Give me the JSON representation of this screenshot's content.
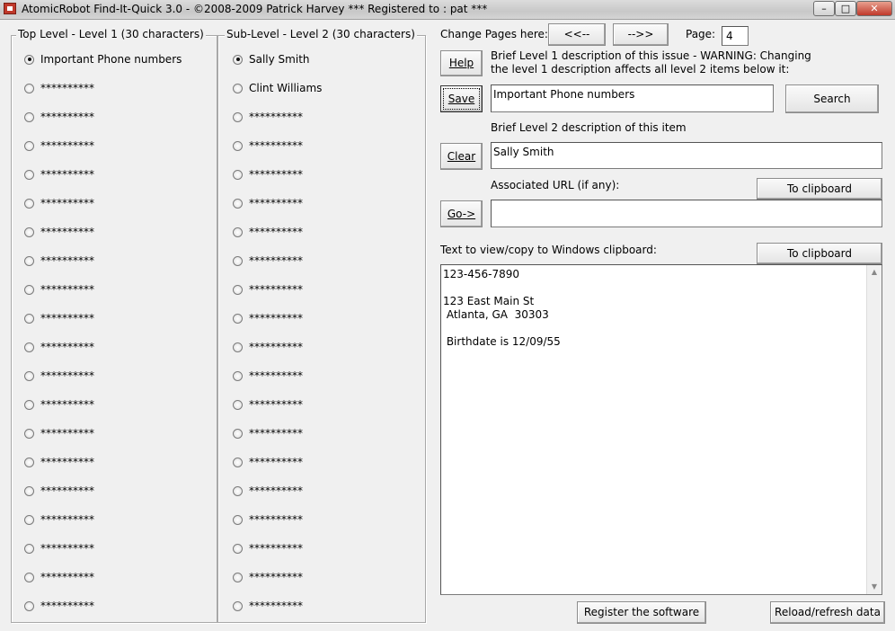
{
  "window": {
    "title": "AtomicRobot Find-It-Quick 3.0 - ©2008-2009 Patrick Harvey *** Registered to : pat ***",
    "min_glyph": "–",
    "max_glyph": "□",
    "close_glyph": "✕"
  },
  "level1": {
    "title": "Top Level - Level 1 (30 characters)",
    "items": [
      "Important Phone numbers",
      "**********",
      "**********",
      "**********",
      "**********",
      "**********",
      "**********",
      "**********",
      "**********",
      "**********",
      "**********",
      "**********",
      "**********",
      "**********",
      "**********",
      "**********",
      "**********",
      "**********",
      "**********",
      "**********"
    ],
    "selected": 0
  },
  "level2": {
    "title": "Sub-Level - Level 2 (30 characters)",
    "items": [
      "Sally Smith",
      "Clint Williams",
      "**********",
      "**********",
      "**********",
      "**********",
      "**********",
      "**********",
      "**********",
      "**********",
      "**********",
      "**********",
      "**********",
      "**********",
      "**********",
      "**********",
      "**********",
      "**********",
      "**********",
      "**********"
    ],
    "selected": 0
  },
  "paging": {
    "label": "Change Pages here:",
    "prev_label": "<<--",
    "next_label": "-->>",
    "page_label": "Page:",
    "page_value": "4"
  },
  "actions": {
    "help_label": "Help",
    "save_label": "Save",
    "clear_label": "Clear",
    "go_label": "Go->",
    "search_label": "Search",
    "register_label": "Register the software",
    "reload_label": "Reload/refresh data"
  },
  "level1_desc": {
    "warning_line1": "Brief Level 1 description of this issue - WARNING: Changing",
    "warning_line2": "the level 1 description affects all level 2 items below it:",
    "value": "Important Phone numbers"
  },
  "level2_desc": {
    "label": "Brief Level 2 description of this item",
    "value": "Sally Smith"
  },
  "url": {
    "label": "Associated URL (if any):",
    "value": "",
    "clipboard_label": "To clipboard"
  },
  "clipboard_text": {
    "label": "Text to view/copy to Windows clipboard:",
    "clipboard_label": "To clipboard",
    "value": "123-456-7890\n\n123 East Main St\n Atlanta, GA  30303\n\n Birthdate is 12/09/55"
  }
}
